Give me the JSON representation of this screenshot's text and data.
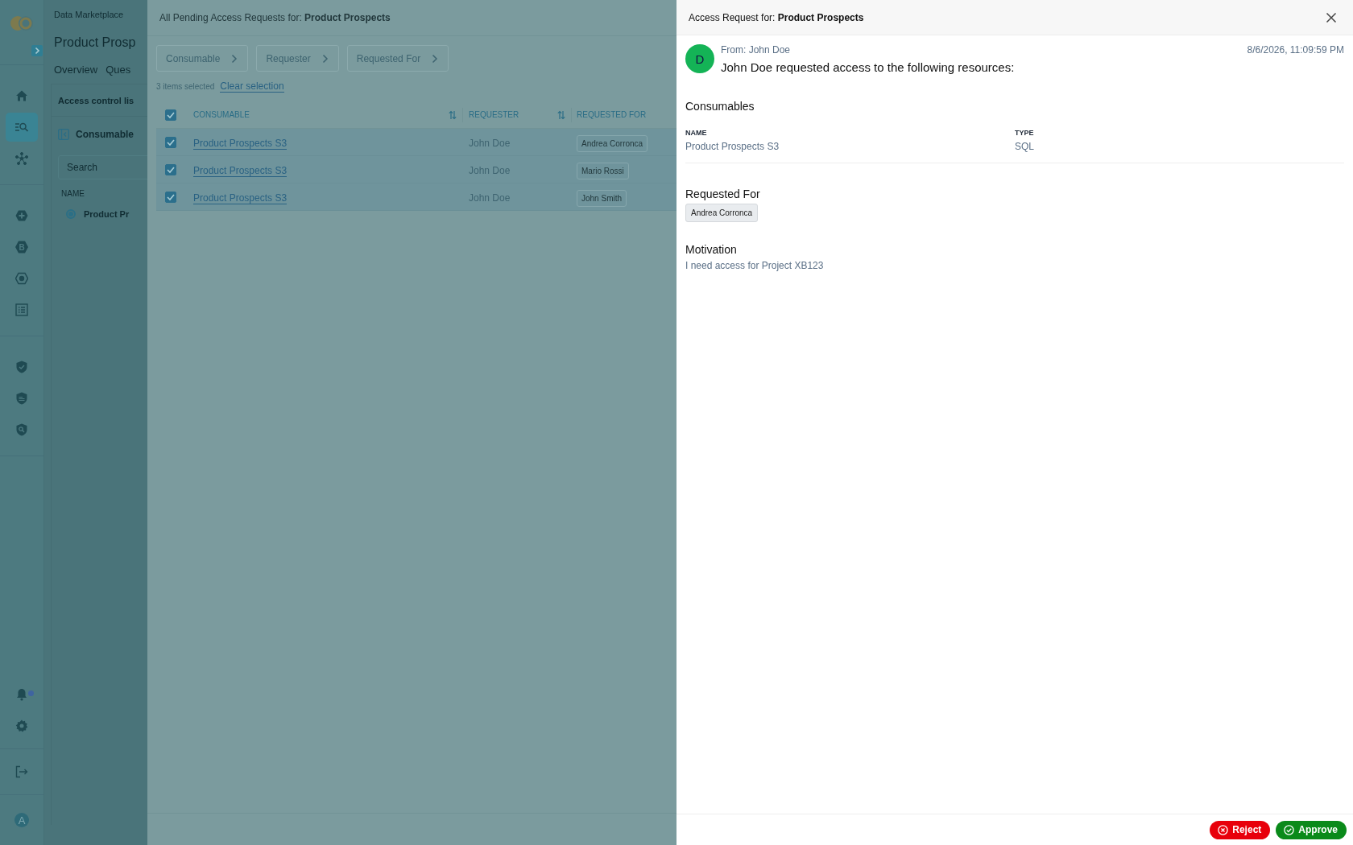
{
  "sidebar": {
    "nav_groups": [
      [
        {
          "selected": false
        },
        {
          "selected": true
        },
        {
          "selected": false
        }
      ],
      [
        {
          "selected": false
        },
        {
          "selected": false,
          "glyph": "B"
        },
        {
          "selected": false
        },
        {
          "selected": false
        }
      ],
      [
        {
          "selected": false
        },
        {
          "selected": false
        },
        {
          "selected": false
        }
      ]
    ],
    "notifications": {
      "unread": true
    },
    "avatar": "A"
  },
  "background_page": {
    "breadcrumb": "Data Marketplace",
    "title": "Product Prosp",
    "tabs": [
      "Overview",
      "Ques"
    ],
    "card_title": "Access control lis",
    "section": "Consumable",
    "search": {
      "placeholder": "Search"
    },
    "column": "NAME",
    "item": {
      "label": "Product Pr",
      "selected": true
    }
  },
  "pending_panel": {
    "title": "All Pending Access Requests for: **Product Prospects**",
    "filters": [
      "Consumable",
      "Requester",
      "Requested For"
    ],
    "selection_count": "3 items selected",
    "clear_link": "Clear selection",
    "table": {
      "all_checked": true,
      "columns": [
        {
          "label": "CONSUMABLE",
          "sortable": true
        },
        {
          "label": "REQUESTER",
          "sortable": true
        },
        {
          "label": "REQUESTED FOR",
          "sortable": false
        }
      ],
      "rows": [
        {
          "checked": true,
          "consumable": "Product Prospects S3",
          "requester": "John Doe",
          "requested_for": "Andrea Corronca"
        },
        {
          "checked": true,
          "consumable": "Product Prospects S3",
          "requester": "John Doe",
          "requested_for": "Mario Rossi"
        },
        {
          "checked": true,
          "consumable": "Product Prospects S3",
          "requester": "John Doe",
          "requested_for": "John Smith"
        }
      ]
    }
  },
  "detail_panel": {
    "title": "Access Request for: **Product Prospects**",
    "avatar": "D",
    "from": "From: John Doe",
    "date": "8/6/2026, 11:09:59 PM",
    "message": "John Doe requested access to the following resources:",
    "consumables": {
      "heading": "Consumables",
      "columns": [
        "NAME",
        "TYPE"
      ],
      "rows": [
        [
          "Product Prospects S3",
          "SQL"
        ]
      ]
    },
    "requested_for": {
      "heading": "Requested For",
      "people": [
        "Andrea Corronca"
      ]
    },
    "motivation": {
      "heading": "Motivation",
      "text": "I need access for Project XB123"
    },
    "buttons": [
      {
        "label": "Reject",
        "kind": "reject"
      },
      {
        "label": "Approve",
        "kind": "approve"
      }
    ]
  }
}
